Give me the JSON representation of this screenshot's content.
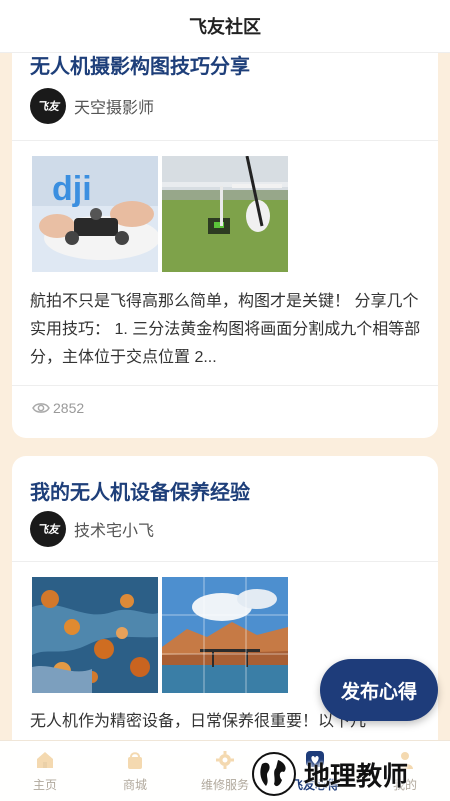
{
  "header": {
    "title": "飞友社区"
  },
  "posts": [
    {
      "title": "无人机摄影构图技巧分享",
      "author": {
        "name": "天空摄影师",
        "avatar_text": "飞友"
      },
      "images": [
        "drone-assembly-photo",
        "fixed-wing-drone-on-grass-photo"
      ],
      "excerpt": "航拍不只是飞得高那么简单，构图才是关键！ 分享几个实用技巧： 1. 三分法黄金构图将画面分割成九个相等部分，主体位于交点位置 2...",
      "views": "2852"
    },
    {
      "title": "我的无人机设备保养经验",
      "author": {
        "name": "技术宅小飞",
        "avatar_text": "飞友"
      },
      "images": [
        "aerial-river-autumn-trees-photo",
        "bridge-canyon-river-photo"
      ],
      "excerpt": "无人机作为精密设备，日常保养很重要！以下几"
    }
  ],
  "publish_button": {
    "label": "发布心得"
  },
  "tabbar": {
    "items": [
      {
        "label": "主页",
        "icon": "home-icon"
      },
      {
        "label": "商城",
        "icon": "shopping-bag-icon"
      },
      {
        "label": "维修服务",
        "icon": "gear-icon"
      },
      {
        "label": "飞友心得",
        "icon": "heart-bubble-icon",
        "active": true
      },
      {
        "label": "我的",
        "icon": "user-icon"
      }
    ]
  },
  "watermark": {
    "text": "地理教师"
  },
  "colors": {
    "accent": "#1e3c7a",
    "background": "#fbeedd",
    "title": "#1e3f7a"
  }
}
